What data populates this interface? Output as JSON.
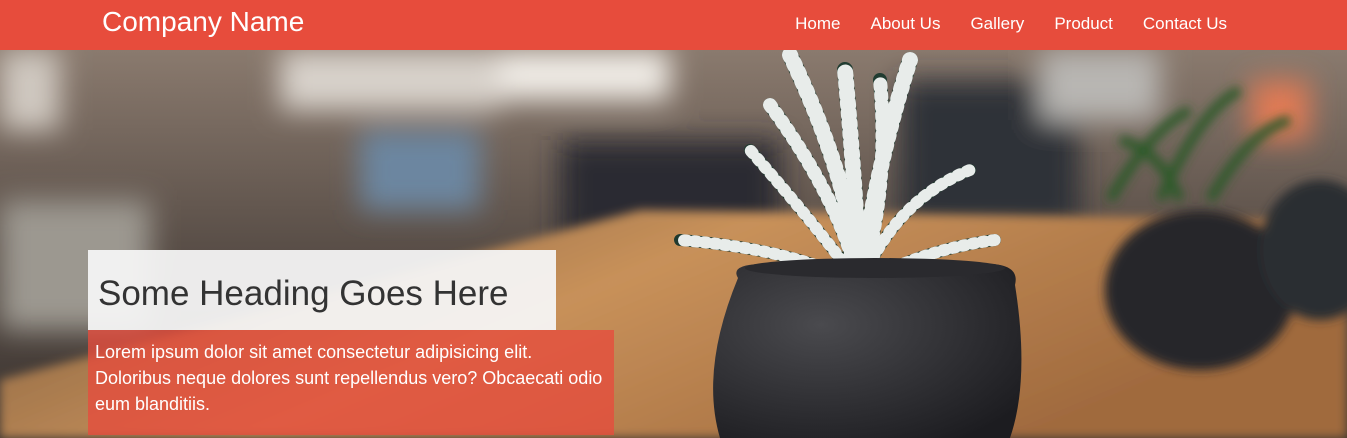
{
  "colors": {
    "accent": "#e74c3c",
    "paragraph_bg": "rgba(231,76,60,0.78)"
  },
  "navbar": {
    "brand": "Company Name",
    "links": [
      "Home",
      "About Us",
      "Gallery",
      "Product",
      "Contact Us"
    ]
  },
  "hero": {
    "heading": "Some Heading Goes Here",
    "paragraph": "Lorem ipsum dolor sit amet consectetur adipisicing elit. Doloribus neque dolores sunt repellendus vero? Obcaecati odio eum blanditiis."
  }
}
